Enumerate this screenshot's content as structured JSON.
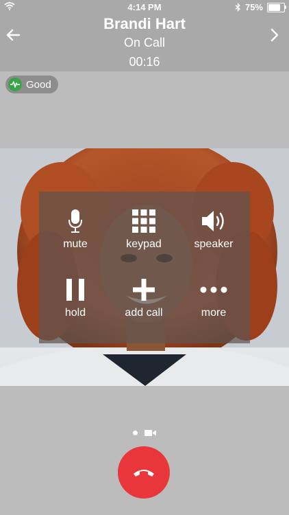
{
  "status_bar": {
    "time": "4:14 PM",
    "battery_percent": "75%",
    "battery_level": 0.75,
    "icons": [
      "wifi-icon",
      "bluetooth-icon",
      "battery-icon"
    ]
  },
  "header": {
    "caller_name": "Brandi Hart",
    "call_status": "On Call",
    "timer": "00:16",
    "back_icon": "arrow-left-icon",
    "forward_icon": "chevron-right-icon"
  },
  "quality": {
    "label": "Good",
    "icon": "signal-pulse-icon",
    "color": "#3aa34a"
  },
  "controls": [
    {
      "id": "mute",
      "label": "mute",
      "icon": "microphone-icon"
    },
    {
      "id": "keypad",
      "label": "keypad",
      "icon": "keypad-icon"
    },
    {
      "id": "speaker",
      "label": "speaker",
      "icon": "speaker-icon"
    },
    {
      "id": "hold",
      "label": "hold",
      "icon": "pause-icon"
    },
    {
      "id": "add-call",
      "label": "add call",
      "icon": "plus-icon"
    },
    {
      "id": "more",
      "label": "more",
      "icon": "more-dots-icon"
    }
  ],
  "page_indicator": {
    "icons": [
      "dot-icon",
      "video-camera-icon"
    ]
  },
  "end_call": {
    "icon": "hang-up-icon",
    "color": "#e8363a"
  },
  "colors": {
    "header_bg": "#a9a9a9",
    "overlay": "rgba(95,85,80,0.72)"
  }
}
